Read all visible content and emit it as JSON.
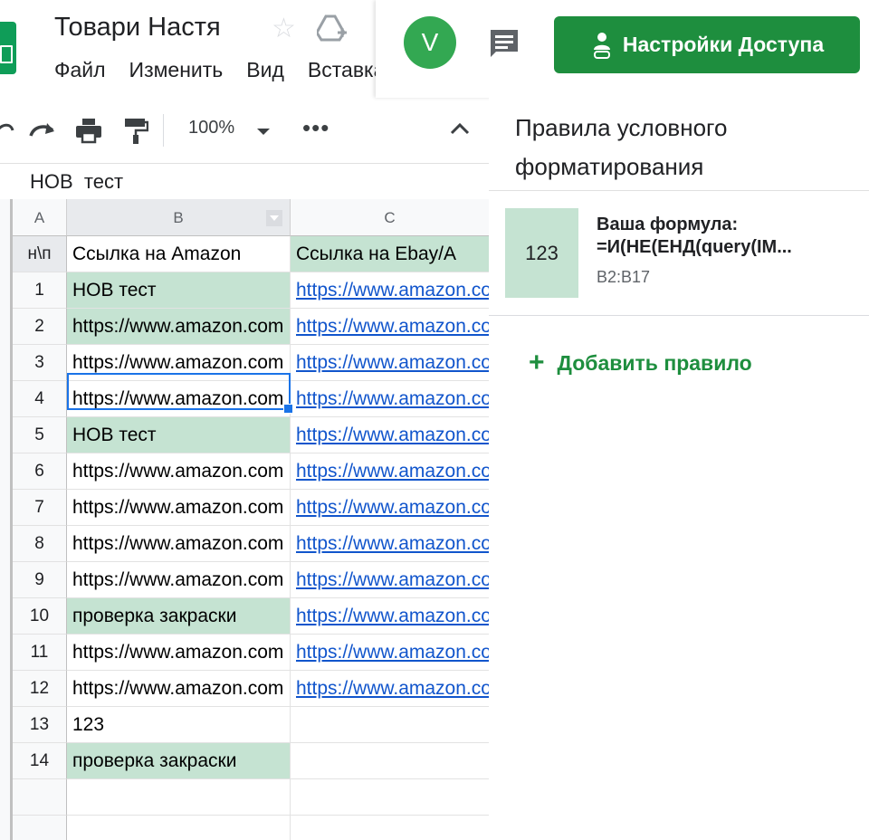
{
  "header": {
    "title": "Товари Настя",
    "menu": [
      "Файл",
      "Изменить",
      "Вид",
      "Вставка"
    ],
    "avatar_letter": "V",
    "share_label": "Настройки Доступа"
  },
  "toolbar": {
    "zoom": "100%"
  },
  "formula_bar": {
    "value": "НОВ  тест"
  },
  "grid": {
    "columns": [
      "A",
      "B",
      "C"
    ],
    "header_row": {
      "a": "н\\п",
      "b": "Ссылка на Amazon",
      "c": "Ссылка на Ebay/А"
    },
    "rows": [
      {
        "num": "1",
        "b": "НОВ тест",
        "c": "https://www.amazon.com"
      },
      {
        "num": "2",
        "b": "https://www.amazon.com",
        "c": "https://www.amazon.com"
      },
      {
        "num": "3",
        "b": "https://www.amazon.com",
        "c": "https://www.amazon.com"
      },
      {
        "num": "4",
        "b": "https://www.amazon.com",
        "c": "https://www.amazon.com"
      },
      {
        "num": "5",
        "b": "НОВ тест",
        "c": "https://www.amazon.com"
      },
      {
        "num": "6",
        "b": "https://www.amazon.com",
        "c": "https://www.amazon.com"
      },
      {
        "num": "7",
        "b": "https://www.amazon.com",
        "c": "https://www.amazon.com"
      },
      {
        "num": "8",
        "b": "https://www.amazon.com",
        "c": "https://www.amazon.com"
      },
      {
        "num": "9",
        "b": "https://www.amazon.com",
        "c": "https://www.amazon.com"
      },
      {
        "num": "10",
        "b": "проверка закраски",
        "c": "https://www.amazon.com"
      },
      {
        "num": "11",
        "b": "https://www.amazon.com",
        "c": "https://www.amazon.com"
      },
      {
        "num": "12",
        "b": "https://www.amazon.com",
        "c": "https://www.amazon.com"
      },
      {
        "num": "13",
        "b": "123",
        "c": ""
      },
      {
        "num": "14",
        "b": "проверка закраски",
        "c": ""
      },
      {
        "num": "",
        "b": "",
        "c": ""
      },
      {
        "num": "",
        "b": "",
        "c": ""
      }
    ],
    "highlight_color": "#c5e3d2",
    "highlighted_rows": [
      "1",
      "2",
      "5",
      "10",
      "14"
    ]
  },
  "panel": {
    "title": "Правила условного форматирования",
    "rule": {
      "preview": "123",
      "line1": "Ваша формула:",
      "line2": "=И(НЕ(ЕНД(query(IM...",
      "range": "B2:B17"
    },
    "add_rule_label": "Добавить правило"
  },
  "colors": {
    "accent_green": "#1e8e3e",
    "avatar_green": "#33a852",
    "link_blue": "#1155cc"
  }
}
